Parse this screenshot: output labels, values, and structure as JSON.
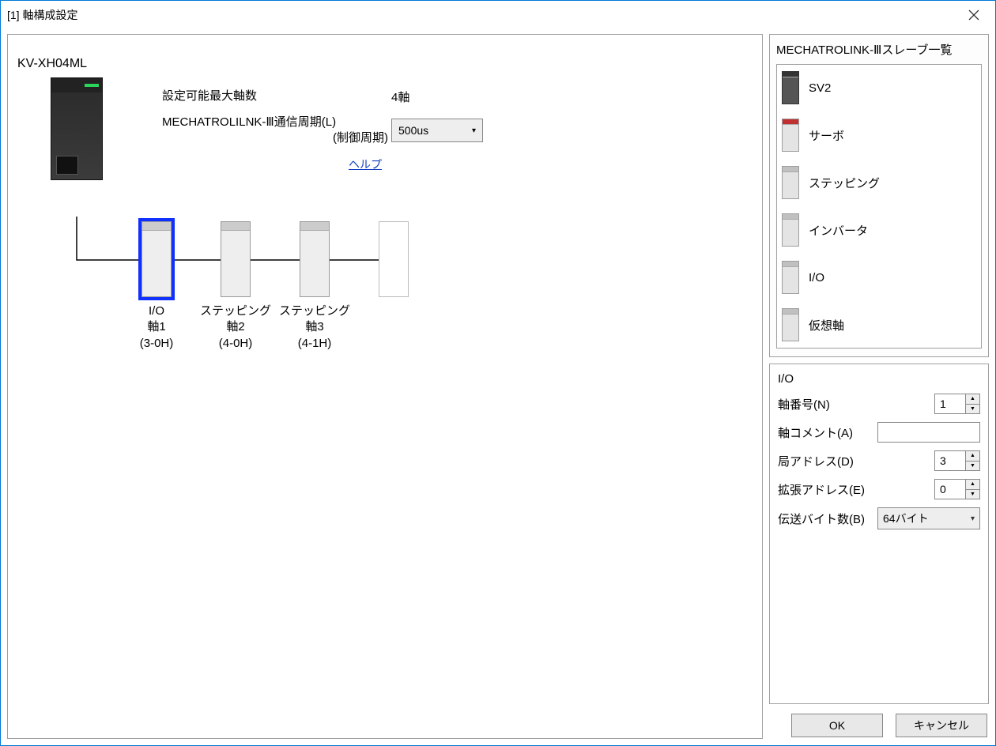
{
  "window": {
    "title": "[1] 軸構成設定"
  },
  "module": {
    "name": "KV-XH04ML"
  },
  "params": {
    "max_axes_label": "設定可能最大軸数",
    "max_axes_value": "4軸",
    "cycle_label": "MECHATROLILNK-Ⅲ通信周期(L)",
    "cycle_sublabel": "(制御周期)",
    "cycle_value": "500us",
    "help": "ヘルプ"
  },
  "nodes": [
    {
      "type": "I/O",
      "axis": "軸1",
      "addr": "(3-0H)",
      "selected": true
    },
    {
      "type": "ステッピング",
      "axis": "軸2",
      "addr": "(4-0H)",
      "selected": false
    },
    {
      "type": "ステッピング",
      "axis": "軸3",
      "addr": "(4-1H)",
      "selected": false
    }
  ],
  "sidebar": {
    "title": "MECHATROLINK-Ⅲスレーブ一覧",
    "items": [
      {
        "label": "SV2"
      },
      {
        "label": "サーボ"
      },
      {
        "label": "ステッピング"
      },
      {
        "label": "インバータ"
      },
      {
        "label": "I/O"
      },
      {
        "label": "仮想軸"
      }
    ]
  },
  "props": {
    "heading": "I/O",
    "axis_no_label": "軸番号(N)",
    "axis_no_value": "1",
    "axis_comment_label": "軸コメント(A)",
    "axis_comment_value": "",
    "station_label": "局アドレス(D)",
    "station_value": "3",
    "ext_label": "拡張アドレス(E)",
    "ext_value": "0",
    "bytes_label": "伝送バイト数(B)",
    "bytes_value": "64バイト"
  },
  "footer": {
    "ok": "OK",
    "cancel": "キャンセル"
  }
}
